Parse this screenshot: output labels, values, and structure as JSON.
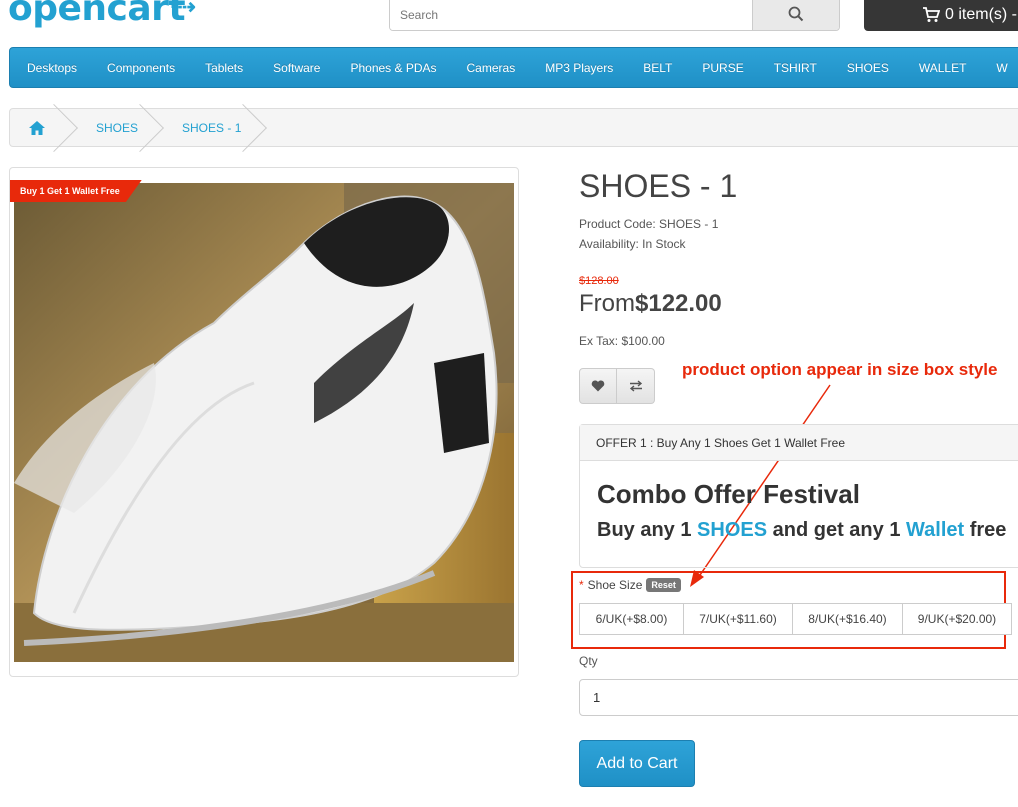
{
  "header": {
    "logo": "opencart",
    "search_placeholder": "Search",
    "cart_label": "0 item(s) -"
  },
  "nav": {
    "items": [
      "Desktops",
      "Components",
      "Tablets",
      "Software",
      "Phones & PDAs",
      "Cameras",
      "MP3 Players",
      "BELT",
      "PURSE",
      "TSHIRT",
      "SHOES",
      "WALLET",
      "W"
    ]
  },
  "breadcrumb": {
    "items": [
      "SHOES",
      "SHOES - 1"
    ]
  },
  "image": {
    "ribbon": "Buy 1 Get 1 Wallet Free"
  },
  "product": {
    "title": "SHOES - 1",
    "code": "Product Code: SHOES - 1",
    "availability": "Availability: In Stock",
    "old_price": "$128.00",
    "price_prefix": "From",
    "price": "$122.00",
    "ex_tax": "Ex Tax: $100.00"
  },
  "annotation": "product option appear in size box style",
  "offer": {
    "header": "OFFER 1 : Buy Any 1 Shoes Get 1 Wallet Free",
    "title": "Combo Offer Festival",
    "sub_1": "Buy any 1 ",
    "sub_2": "SHOES",
    "sub_3": " and get any 1 ",
    "sub_4": "Wallet",
    "sub_5": " free"
  },
  "options": {
    "label": "Shoe Size",
    "required_mark": "*",
    "reset": "Reset",
    "sizes": [
      "6/UK(+$8.00)",
      "7/UK(+$11.60)",
      "8/UK(+$16.40)",
      "9/UK(+$20.00)"
    ]
  },
  "qty": {
    "label": "Qty",
    "value": "1"
  },
  "add_to_cart": "Add to Cart",
  "colors": {
    "accent": "#23a1d1",
    "annotation_red": "#e8290b"
  }
}
